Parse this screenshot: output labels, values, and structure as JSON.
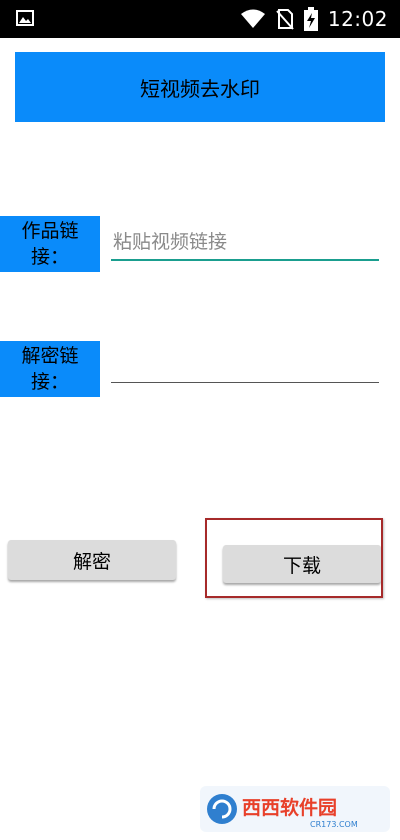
{
  "status_bar": {
    "time": "12:02",
    "icons": [
      "image-icon",
      "wifi-icon",
      "no-sim-icon",
      "battery-charging-icon"
    ]
  },
  "header": {
    "title": "短视频去水印"
  },
  "form": {
    "work_link_label": "作品链接：",
    "work_link_placeholder": "粘贴视频链接",
    "work_link_value": "",
    "decrypt_link_label": "解密链接：",
    "decrypt_link_value": ""
  },
  "buttons": {
    "decrypt_label": "解密",
    "download_label": "下载"
  },
  "watermark": {
    "brand": "西西软件园",
    "site": "CR173.COM"
  },
  "colors": {
    "accent": "#0a8bfa",
    "input_focus": "#1a9e8f",
    "highlight": "#a62a2a"
  }
}
